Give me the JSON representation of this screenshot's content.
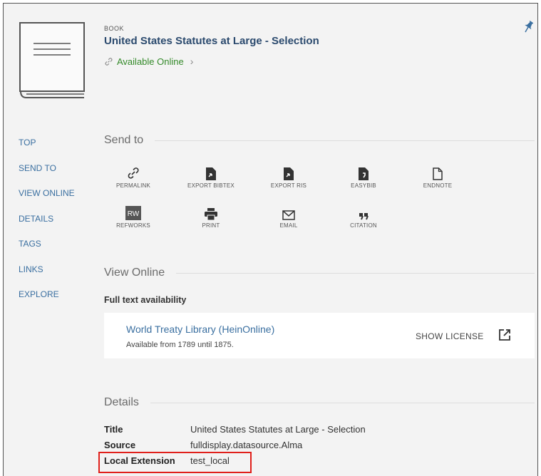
{
  "record": {
    "type": "BOOK",
    "title": "United States Statutes at Large - Selection",
    "availability": "Available Online",
    "availability_color": "#348a2a"
  },
  "nav": [
    "TOP",
    "SEND TO",
    "VIEW ONLINE",
    "DETAILS",
    "TAGS",
    "LINKS",
    "EXPLORE"
  ],
  "send_to": {
    "heading": "Send to",
    "actions": [
      {
        "label": "PERMALINK",
        "icon": "link-icon"
      },
      {
        "label": "EXPORT BIBTEX",
        "icon": "file-export-icon"
      },
      {
        "label": "EXPORT RIS",
        "icon": "file-export-icon"
      },
      {
        "label": "EASYBIB",
        "icon": "easybib-icon"
      },
      {
        "label": "ENDNOTE",
        "icon": "document-icon"
      },
      {
        "label": "REFWORKS",
        "icon": "refworks-icon"
      },
      {
        "label": "PRINT",
        "icon": "printer-icon"
      },
      {
        "label": "EMAIL",
        "icon": "envelope-icon"
      },
      {
        "label": "CITATION",
        "icon": "quote-icon"
      }
    ]
  },
  "view_online": {
    "heading": "View Online",
    "subheading": "Full text availability",
    "service_name": "World Treaty Library (HeinOnline)",
    "service_range": "Available from 1789 until 1875.",
    "show_license": "SHOW LICENSE"
  },
  "details": {
    "heading": "Details",
    "rows": [
      {
        "label": "Title",
        "value": "United States Statutes at Large - Selection"
      },
      {
        "label": "Source",
        "value": "fulldisplay.datasource.Alma"
      },
      {
        "label": "Local Extension",
        "value": "test_local"
      }
    ]
  },
  "colors": {
    "link": "#3a6fa0",
    "title": "#2b4a6e",
    "highlight": "#e0201b"
  }
}
